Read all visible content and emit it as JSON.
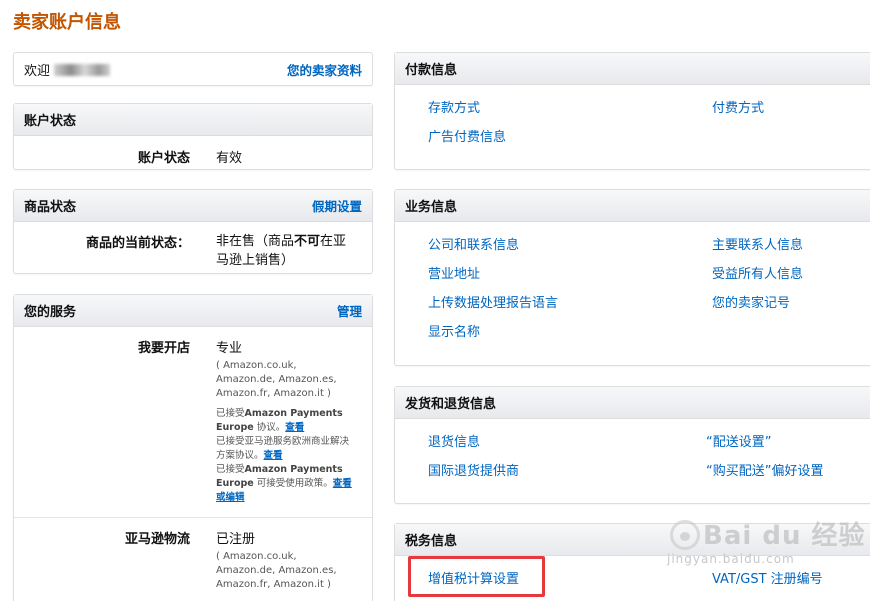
{
  "page": {
    "title": "卖家账户信息",
    "accent": "#c45500",
    "link_color": "#0066c0",
    "highlight_color": "#e6393d"
  },
  "welcome": {
    "label": "欢迎",
    "profile_link": "您的卖家资料"
  },
  "account_status": {
    "title": "账户状态",
    "label": "账户状态",
    "value": "有效"
  },
  "listing_status": {
    "title": "商品状态",
    "action": "假期设置",
    "label": "商品的当前状态：",
    "value_part1": "非在售（商品",
    "value_bold": "不可",
    "value_part2": "在亚马逊上销售）"
  },
  "services": {
    "title": "您的服务",
    "action": "管理",
    "items": [
      {
        "label": "我要开店",
        "value": "专业",
        "sites": "( Amazon.co.uk, Amazon.de, Amazon.es, Amazon.fr, Amazon.it )",
        "note1_pre": "已接受",
        "note1_bold": "Amazon Payments Europe",
        "note1_post": "协议。",
        "note1_link": "查看",
        "note2_text": "已接受亚马逊服务欧洲商业解决方案协议。",
        "note2_link": "查看",
        "note3_pre": "已接受",
        "note3_bold": "Amazon Payments Europe",
        "note3_post": "可接受使用政策。",
        "note3_link": "查看或编辑"
      },
      {
        "label": "亚马逊物流",
        "value": "已注册",
        "sites": "( Amazon.co.uk, Amazon.de, Amazon.es, Amazon.fr, Amazon.it )"
      }
    ]
  },
  "payment": {
    "title": "付款信息",
    "links": [
      "存款方式",
      "付费方式",
      "广告付费信息"
    ]
  },
  "business": {
    "title": "业务信息",
    "links": [
      "公司和联系信息",
      "主要联系人信息",
      "营业地址",
      "受益所有人信息",
      "上传数据处理报告语言",
      "您的卖家记号",
      "显示名称"
    ]
  },
  "shipping": {
    "title": "发货和退货信息",
    "links": [
      "退货信息",
      "“配送设置”",
      "国际退货提供商",
      "“购买配送”偏好设置"
    ]
  },
  "tax": {
    "title": "税务信息",
    "links": [
      "增值税计算设置",
      "VAT/GST 注册编号"
    ]
  },
  "watermark": {
    "logo": "Bai du 经验",
    "url": "jingyan.baidu.com"
  }
}
